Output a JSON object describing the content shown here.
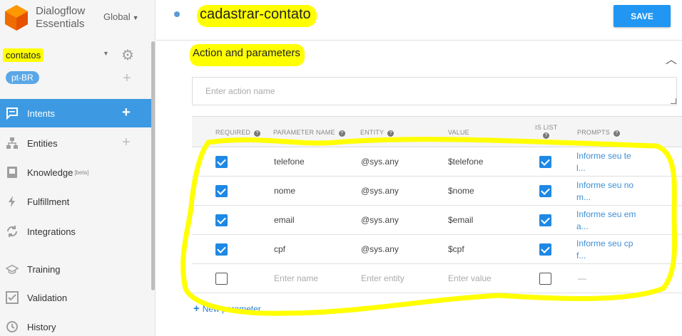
{
  "brand": {
    "line1": "Dialogflow",
    "line2": "Essentials"
  },
  "region": "Global",
  "agent": {
    "name": "contatos",
    "language": "pt-BR"
  },
  "nav": [
    {
      "label": "Intents",
      "icon": "chat-icon",
      "active": true,
      "add": true
    },
    {
      "label": "Entities",
      "icon": "hierarchy-icon",
      "active": false,
      "add": true
    },
    {
      "label": "Knowledge",
      "beta": "[beta]",
      "icon": "book-icon",
      "active": false,
      "add": false
    },
    {
      "label": "Fulfillment",
      "icon": "bolt-icon",
      "active": false,
      "add": false
    },
    {
      "label": "Integrations",
      "icon": "sync-icon",
      "active": false,
      "add": false
    },
    {
      "label": "Training",
      "icon": "graduation-cap-icon",
      "active": false,
      "add": false
    },
    {
      "label": "Validation",
      "icon": "check-square-icon",
      "active": false,
      "add": false
    },
    {
      "label": "History",
      "icon": "clock-icon",
      "active": false,
      "add": false
    }
  ],
  "intent": {
    "title": "cadastrar-contato"
  },
  "save_label": "SAVE",
  "section": {
    "title": "Action and parameters",
    "action_placeholder": "Enter action name"
  },
  "table": {
    "headers": {
      "required": "REQUIRED",
      "param": "PARAMETER NAME",
      "entity": "ENTITY",
      "value": "VALUE",
      "islist_1": "IS LIST",
      "prompts": "PROMPTS"
    },
    "rows": [
      {
        "required": true,
        "name": "telefone",
        "entity": "@sys.any",
        "value": "$telefone",
        "is_list": true,
        "prompt_1": "Informe seu te",
        "prompt_2": "l..."
      },
      {
        "required": true,
        "name": "nome",
        "entity": "@sys.any",
        "value": "$nome",
        "is_list": true,
        "prompt_1": "Informe seu no",
        "prompt_2": "m..."
      },
      {
        "required": true,
        "name": "email",
        "entity": "@sys.any",
        "value": "$email",
        "is_list": true,
        "prompt_1": "Informe seu em",
        "prompt_2": "a..."
      },
      {
        "required": true,
        "name": "cpf",
        "entity": "@sys.any",
        "value": "$cpf",
        "is_list": true,
        "prompt_1": "Informe seu cp",
        "prompt_2": "f..."
      }
    ],
    "new_row": {
      "name_placeholder": "Enter name",
      "entity_placeholder": "Enter entity",
      "value_placeholder": "Enter value",
      "prompt_placeholder": "—"
    }
  },
  "new_parameter_label": "New parameter",
  "colors": {
    "accent": "#2196f3",
    "active_nav": "#3d9ae2",
    "highlight": "#ffff00",
    "logo": "#ef6c00"
  }
}
